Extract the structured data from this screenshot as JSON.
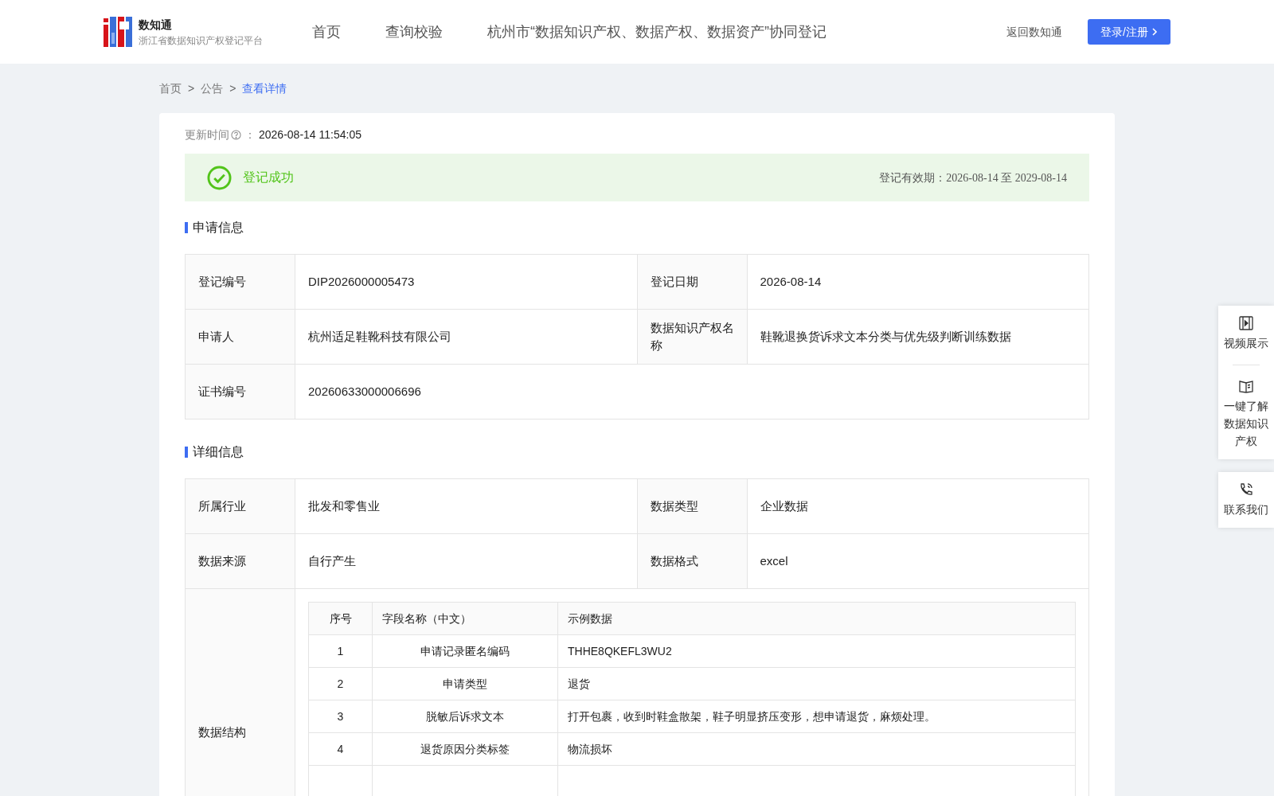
{
  "header": {
    "logo_title": "数知通",
    "logo_subtitle": "浙江省数据知识产权登记平台",
    "nav": [
      {
        "label": "首页",
        "selected": false
      },
      {
        "label": "查询校验",
        "selected": false
      },
      {
        "label": "杭州市“数据知识产权、数据产权、数据资产”协同登记",
        "selected": false
      }
    ],
    "back_link": "返回数知通",
    "login_button": "登录/注册"
  },
  "breadcrumb": [
    {
      "label": "首页",
      "current": false
    },
    {
      "label": "公告",
      "current": false
    },
    {
      "label": "查看详情",
      "current": true
    }
  ],
  "breadcrumb_separator": ">",
  "update_time": {
    "label": "更新时间",
    "colon": "：",
    "value": "2026-08-14 11:54:05"
  },
  "status": {
    "text": "登记成功",
    "validity": "登记有效期：2026-08-14 至 2029-08-14"
  },
  "sections": [
    {
      "title": "申请信息",
      "rows": [
        [
          {
            "label": "登记编号",
            "value": "DIP2026000005473"
          },
          {
            "label": "登记日期",
            "value": "2026-08-14"
          }
        ],
        [
          {
            "label": "申请人",
            "value": "杭州适足鞋靴科技有限公司"
          },
          {
            "label": "数据知识产权名称",
            "value": "鞋靴退换货诉求文本分类与优先级判断训练数据"
          }
        ],
        [
          {
            "label": "证书编号",
            "value": "20260633000006696"
          }
        ]
      ]
    },
    {
      "title": "详细信息",
      "rows": [
        [
          {
            "label": "所属行业",
            "value": "批发和零售业"
          },
          {
            "label": "数据类型",
            "value": "企业数据"
          }
        ],
        [
          {
            "label": "数据来源",
            "value": "自行产生"
          },
          {
            "label": "数据格式",
            "value": "excel"
          }
        ]
      ],
      "structure": {
        "label": "数据结构",
        "columns": [
          "序号",
          "字段名称（中文）",
          "示例数据"
        ],
        "rows": [
          [
            "1",
            "申请记录匿名编码",
            "THHE8QKEFL3WU2"
          ],
          [
            "2",
            "申请类型",
            "退货"
          ],
          [
            "3",
            "脱敏后诉求文本",
            "打开包裹，收到时鞋盒散架，鞋子明显挤压变形，想申请退货，麻烦处理。"
          ],
          [
            "4",
            "退货原因分类标签",
            "物流损坏"
          ]
        ]
      }
    }
  ],
  "side_widget": [
    {
      "kind": "video",
      "label": "视频展示"
    },
    {
      "kind": "book",
      "label": "一键了解数据知识产权"
    },
    {
      "kind": "phone",
      "label": "联系我们"
    }
  ]
}
